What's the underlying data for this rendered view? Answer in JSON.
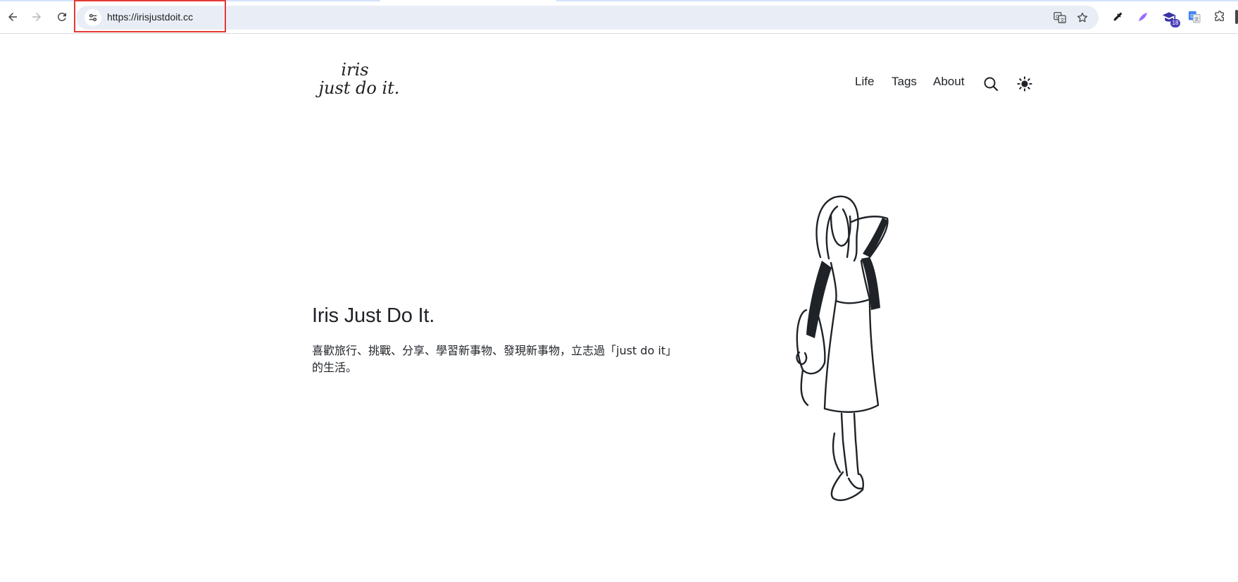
{
  "browser": {
    "url": "https://irisjustdoit.cc",
    "extension_badge": "18",
    "icons": {
      "back": "back-arrow-icon",
      "forward": "forward-arrow-icon",
      "reload": "reload-icon",
      "site_info": "tune-icon",
      "translate": "translate-icon",
      "bookmark": "star-icon",
      "eyedropper": "eyedropper-icon",
      "extensions": "puzzle-icon"
    }
  },
  "site": {
    "logo_line1": "iris",
    "logo_line2": "just do it.",
    "nav": {
      "life": "Life",
      "tags": "Tags",
      "about": "About"
    },
    "icons": {
      "search": "search-icon",
      "theme": "sun-icon"
    }
  },
  "hero": {
    "title": "Iris Just Do It.",
    "description": "喜歡旅行、挑戰、分享、學習新事物、發現新事物，立志過「just do it」的生活。"
  },
  "colors": {
    "text": "#1f2328",
    "omnibox": "#e9eef6",
    "highlight": "#e53935",
    "illustration_fill": "#1f2328"
  }
}
